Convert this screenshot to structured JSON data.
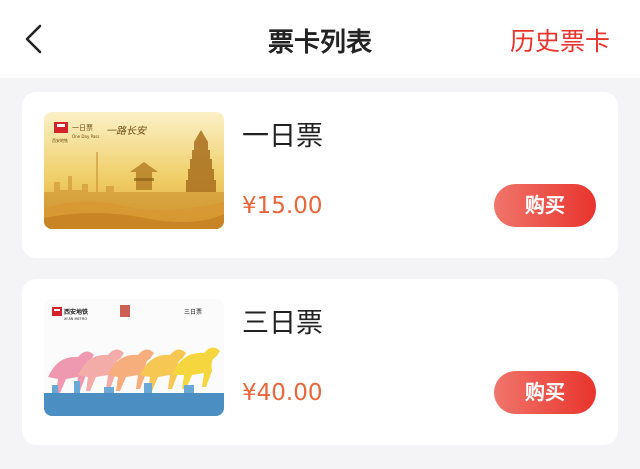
{
  "header": {
    "title": "票卡列表",
    "history_label": "历史票卡"
  },
  "tickets": [
    {
      "name": "一日票",
      "price": "¥15.00",
      "buy_label": "购买",
      "card_text": {
        "brand": "西安地铁",
        "type": "一日票",
        "type_en": "One Day Pass",
        "slogan": "一路长安"
      }
    },
    {
      "name": "三日票",
      "price": "¥40.00",
      "buy_label": "购买",
      "card_text": {
        "brand": "西安地铁",
        "brand_en": "XI'AN METRO",
        "type": "三日票"
      }
    }
  ],
  "colors": {
    "accent": "#e8342c",
    "price": "#e8673a"
  }
}
